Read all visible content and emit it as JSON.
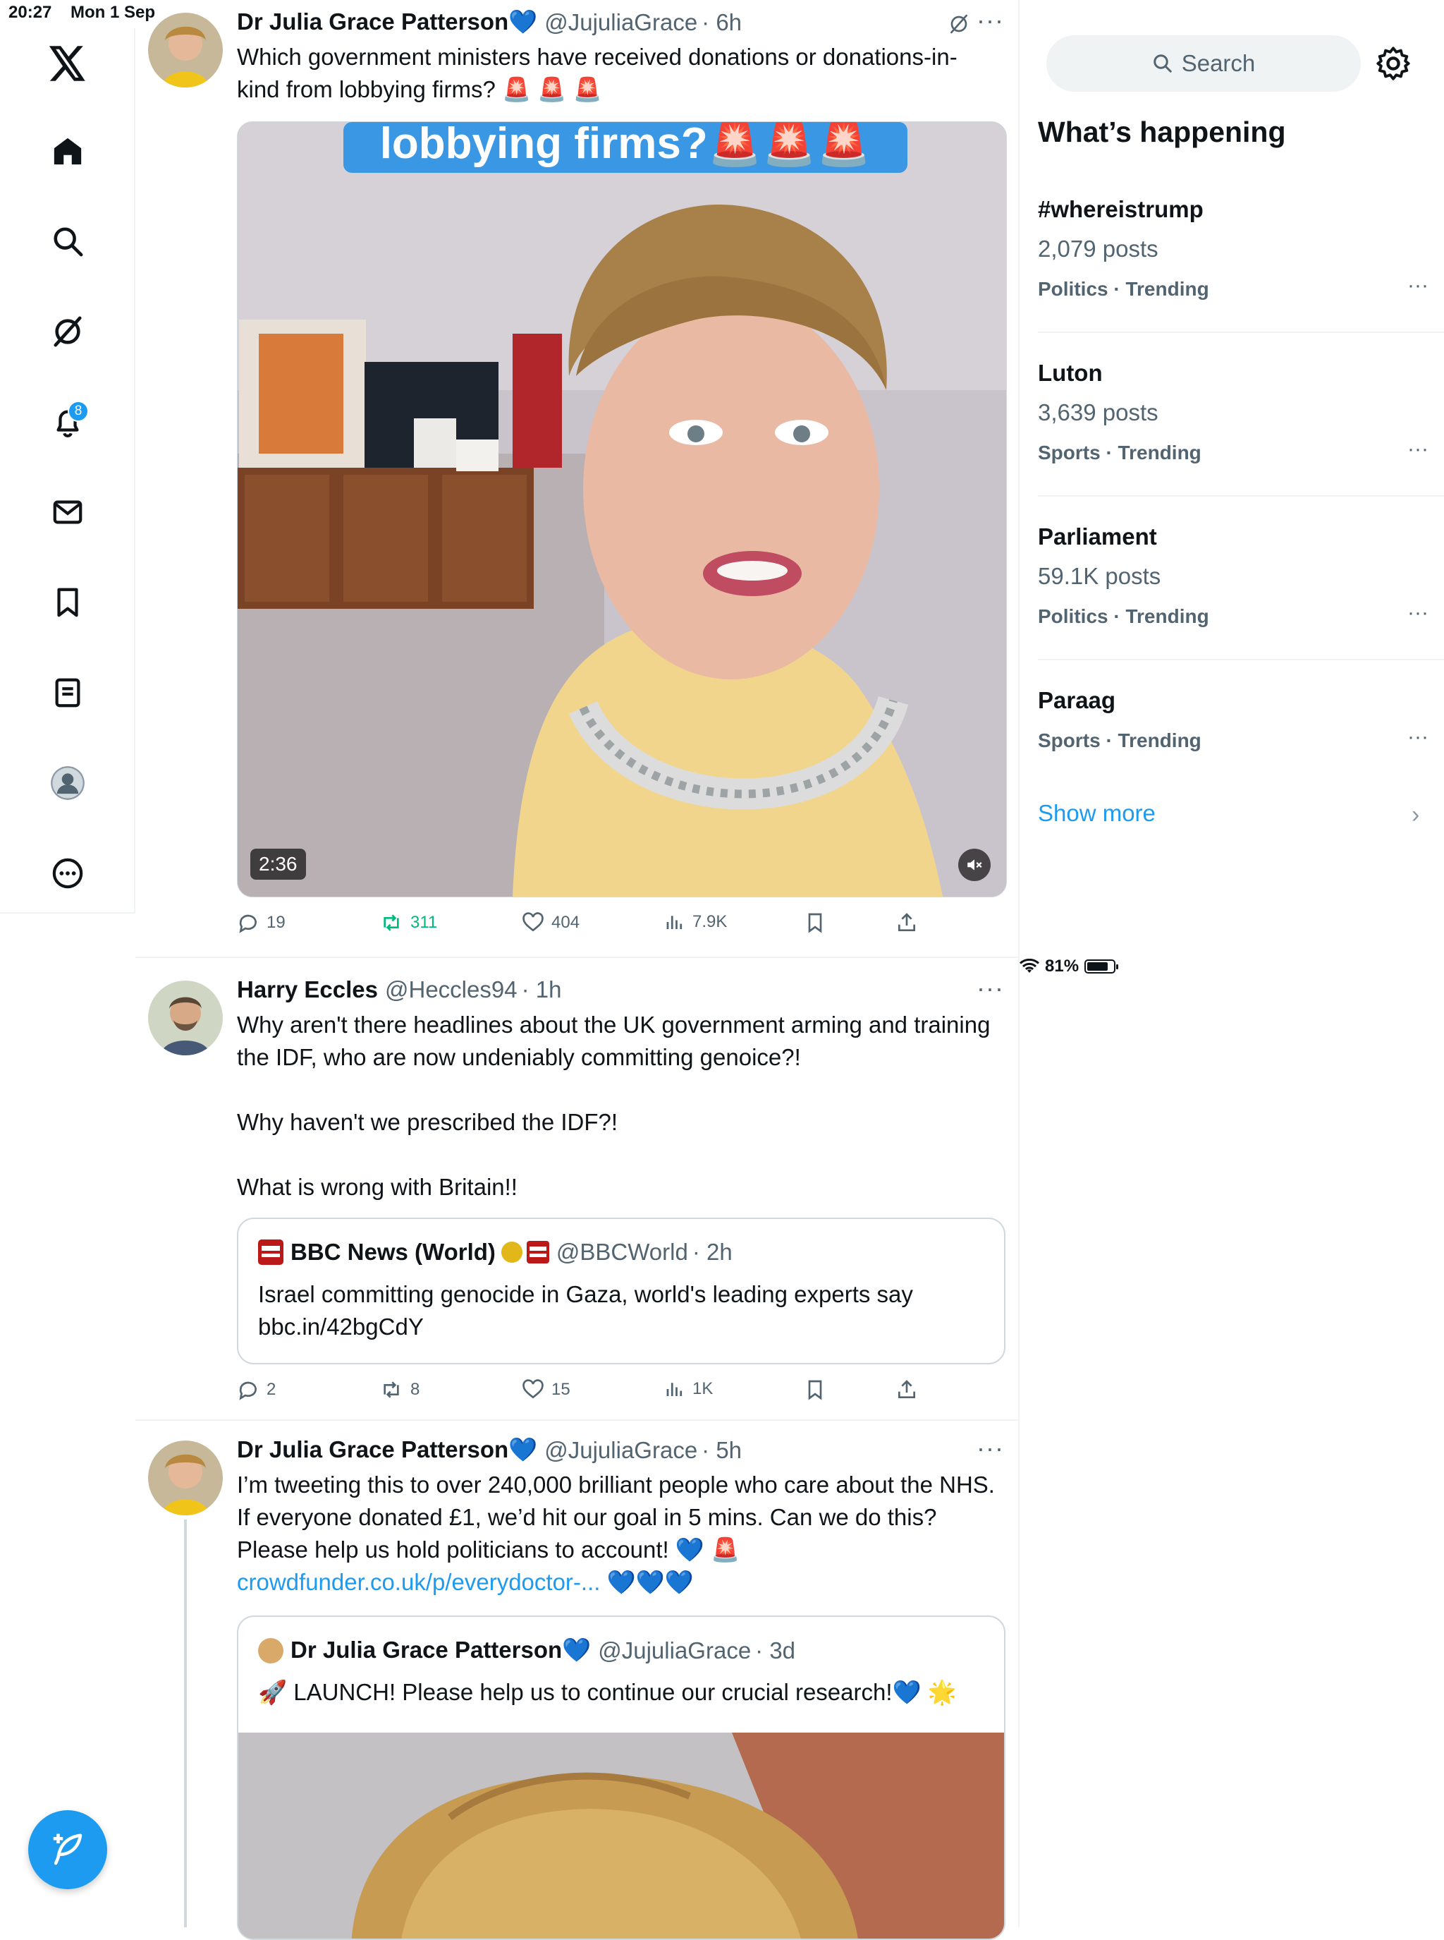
{
  "status": {
    "time": "20:27",
    "date": "Mon 1 Sep",
    "battery": "81%",
    "battery_level": 0.81
  },
  "nav": {
    "notifications_badge": "8"
  },
  "tweets": [
    {
      "name": "Dr Julia Grace Patterson💙",
      "handle": "@JujuliaGrace",
      "time": "· 6h",
      "text": "Which government ministers have received donations or donations-in-kind from lobbying firms? 🚨 🚨 🚨",
      "video_caption": "lobbying firms?🚨🚨🚨",
      "video_duration": "2:36",
      "replies": "19",
      "retweets": "311",
      "likes": "404",
      "views": "7.9K"
    },
    {
      "name": "Harry Eccles",
      "handle": "@Heccles94",
      "time": "· 1h",
      "para1": "Why aren't there headlines about the UK government arming and training the IDF, who are now undeniably committing genoice?!",
      "para2": "Why haven't we prescribed the IDF?!",
      "para3": "What is wrong with Britain!!",
      "quote": {
        "name": "BBC News (World)",
        "handle": "@BBCWorld",
        "time": "· 2h",
        "text": "Israel committing genocide in Gaza, world's leading experts say",
        "link": "bbc.in/42bgCdY"
      },
      "replies": "2",
      "retweets": "8",
      "likes": "15",
      "views": "1K"
    },
    {
      "name": "Dr Julia Grace Patterson💙",
      "handle": "@JujuliaGrace",
      "time": "· 5h",
      "text": "I’m tweeting this to over 240,000 brilliant people who care about the NHS. If everyone donated £1, we’d hit our goal in 5 mins. Can we do this? Please help us hold politicians to account! 💙 🚨",
      "link": "crowdfunder.co.uk/p/everydoctor-...",
      "link_suffix": " 💙💙💙",
      "quote": {
        "name": "Dr Julia Grace Patterson💙",
        "handle": "@JujuliaGrace",
        "time": "· 3d",
        "text": "🚀 LAUNCH! Please help us to continue our crucial research!💙 🌟"
      }
    }
  ],
  "sidebar": {
    "search_placeholder": "Search",
    "title": "What’s happening",
    "trends": [
      {
        "name": "#whereistrump",
        "count": "2,079 posts",
        "category": "Politics · Trending"
      },
      {
        "name": "Luton",
        "count": "3,639 posts",
        "category": "Sports · Trending"
      },
      {
        "name": "Parliament",
        "count": "59.1K posts",
        "category": "Politics · Trending"
      },
      {
        "name": "Paraag",
        "count": "",
        "category": "Sports · Trending"
      }
    ],
    "show_more": "Show more"
  },
  "colors": {
    "accent": "#1d9bf0",
    "retweet": "#00ba7c",
    "muted": "#536471"
  }
}
